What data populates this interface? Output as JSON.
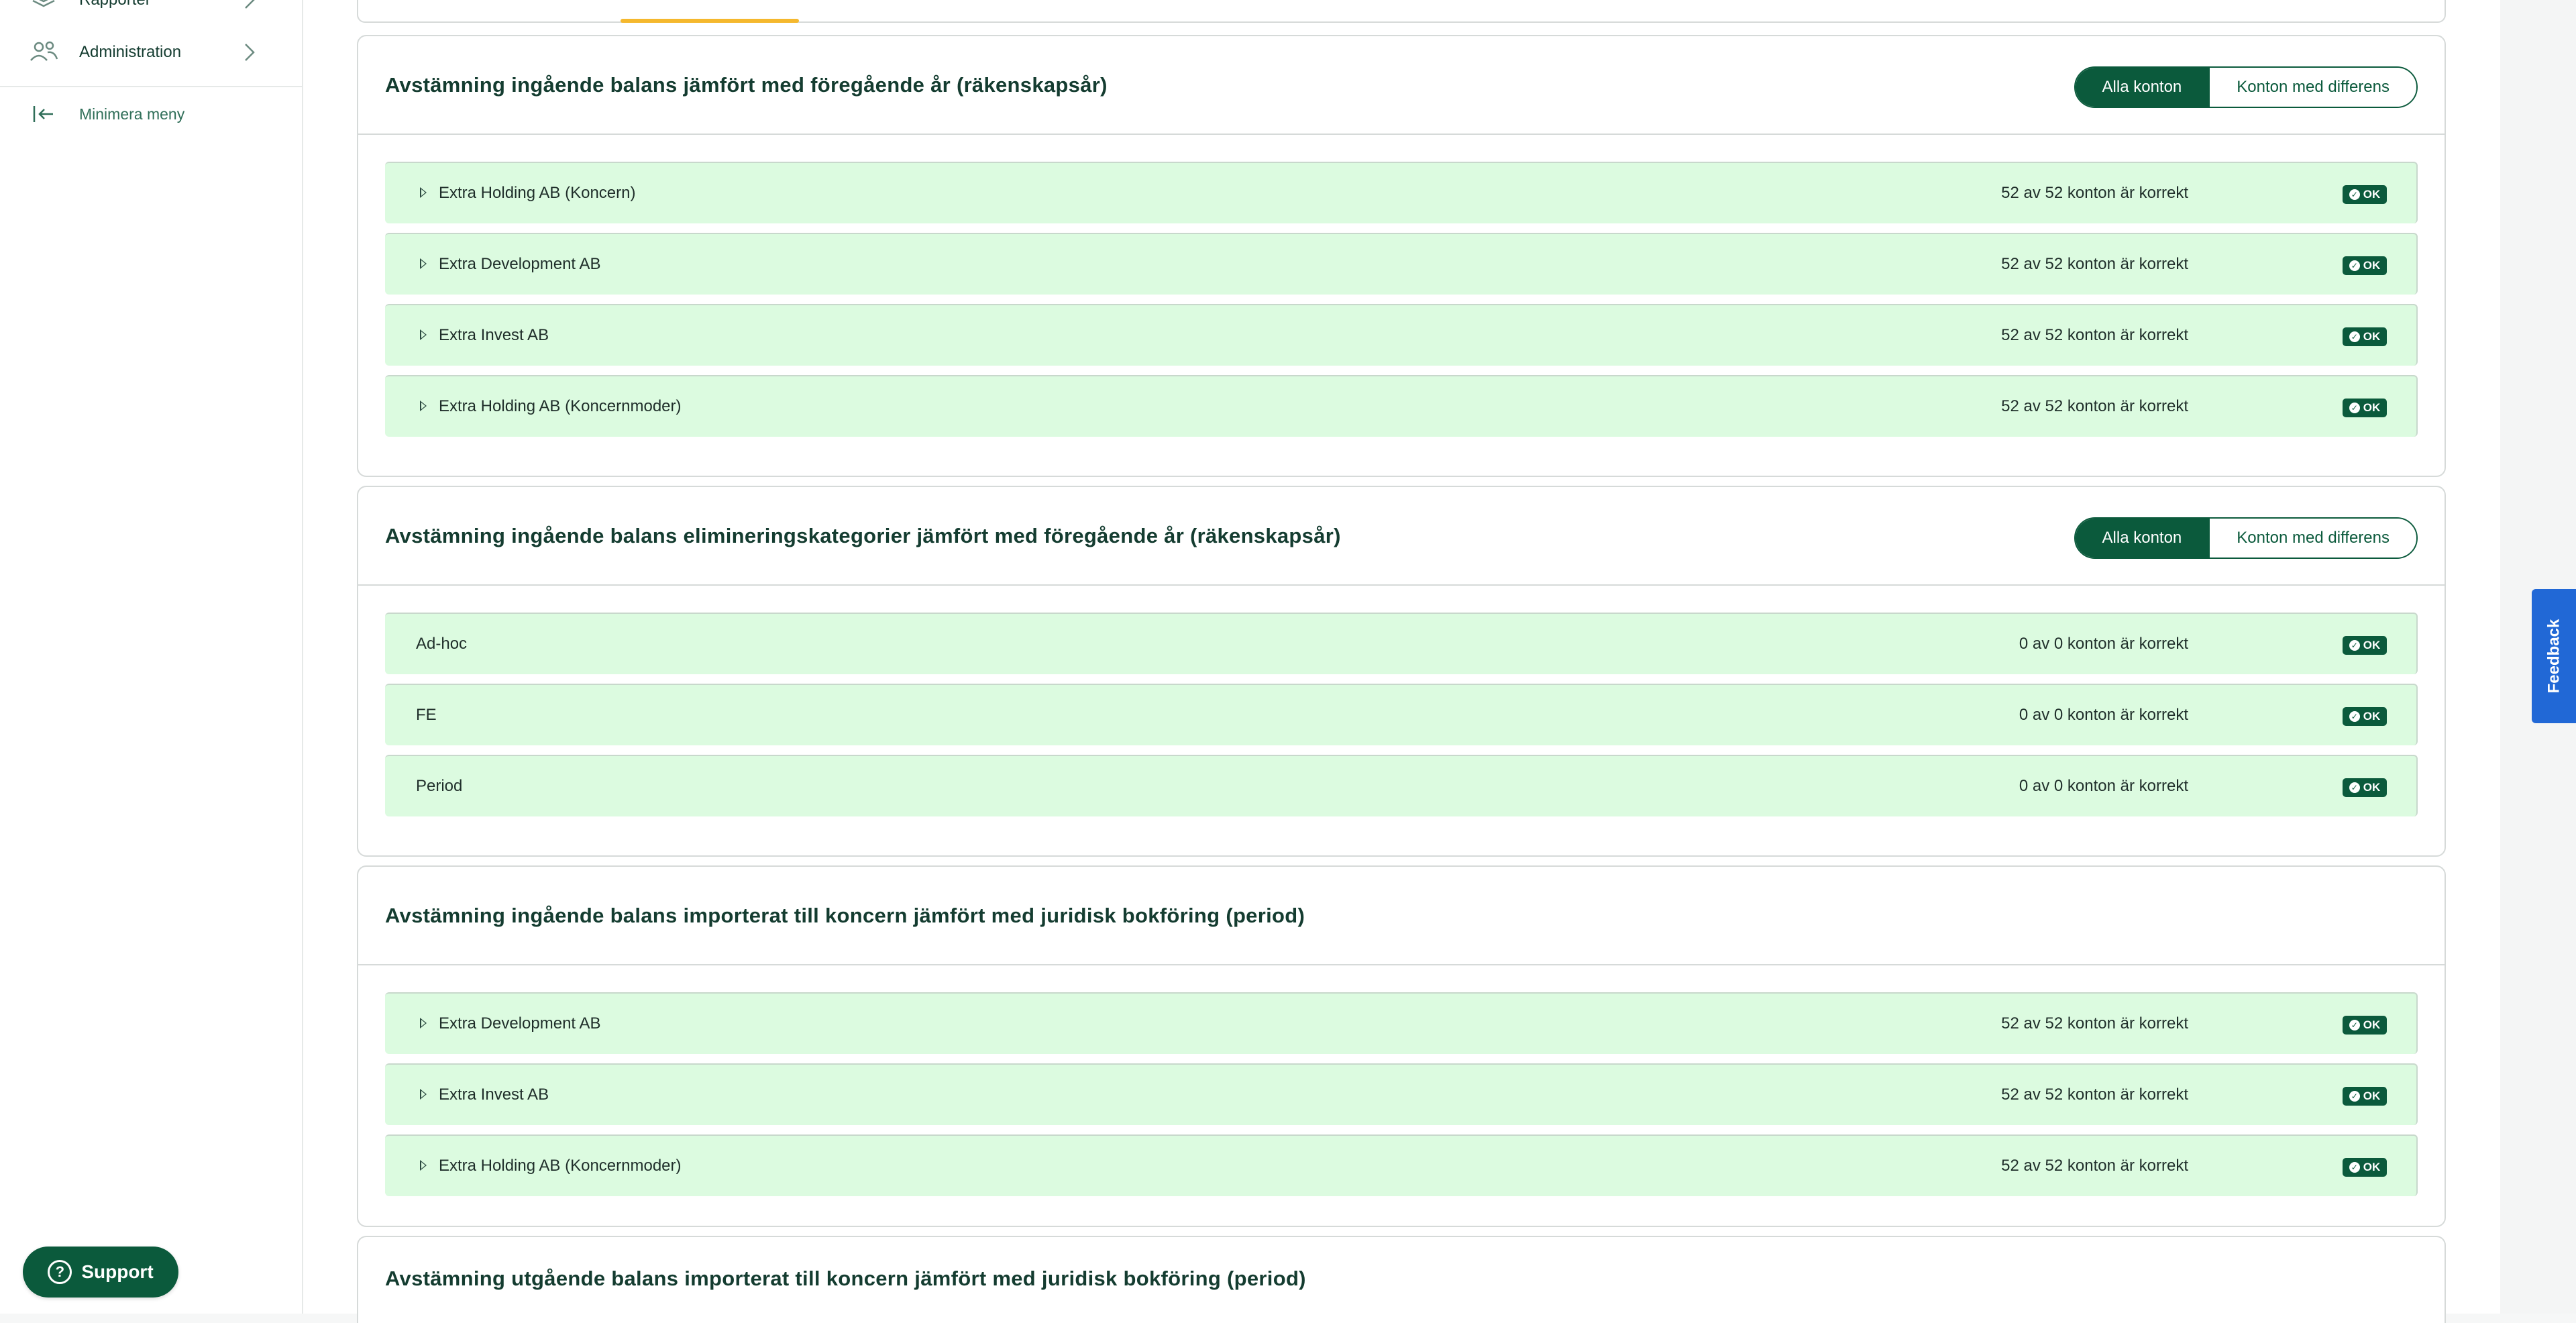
{
  "sidebar": {
    "items": [
      {
        "label": "Rapporter",
        "icon": "layers-icon"
      },
      {
        "label": "Administration",
        "icon": "users-icon"
      }
    ],
    "minimize_label": "Minimera meny"
  },
  "support": {
    "label": "Support"
  },
  "feedback": {
    "label": "Feedback"
  },
  "toggle": {
    "all": "Alla konton",
    "diff": "Konton med differens"
  },
  "badge_label": "OK",
  "sections": [
    {
      "title": "Avstämning ingående balans jämfört med föregående år (räkenskapsår)",
      "rows": [
        {
          "name": "Extra Holding AB (Koncern)",
          "status": "52 av 52 konton är korrekt"
        },
        {
          "name": "Extra Development AB",
          "status": "52 av 52 konton är korrekt"
        },
        {
          "name": "Extra Invest AB",
          "status": "52 av 52 konton är korrekt"
        },
        {
          "name": "Extra Holding AB (Koncernmoder)",
          "status": "52 av 52 konton är korrekt"
        }
      ]
    },
    {
      "title": "Avstämning ingående balans elimineringskategorier jämfört med föregående år (räkenskapsår)",
      "rows": [
        {
          "name": "Ad-hoc",
          "status": "0 av 0 konton är korrekt"
        },
        {
          "name": "FE",
          "status": "0 av 0 konton är korrekt"
        },
        {
          "name": "Period",
          "status": "0 av 0 konton är korrekt"
        }
      ]
    },
    {
      "title": "Avstämning ingående balans importerat till koncern jämfört med juridisk bokföring (period)",
      "rows": [
        {
          "name": "Extra Development AB",
          "status": "52 av 52 konton är korrekt"
        },
        {
          "name": "Extra Invest AB",
          "status": "52 av 52 konton är korrekt"
        },
        {
          "name": "Extra Holding AB (Koncernmoder)",
          "status": "52 av 52 konton är korrekt"
        }
      ]
    },
    {
      "title": "Avstämning utgående balans importerat till koncern jämfört med juridisk bokföring (period)"
    }
  ],
  "colors": {
    "brand": "#0b5a3c",
    "row_ok": "#dcfbe0",
    "accent": "#f5b82e",
    "feedback": "#2168d6"
  }
}
